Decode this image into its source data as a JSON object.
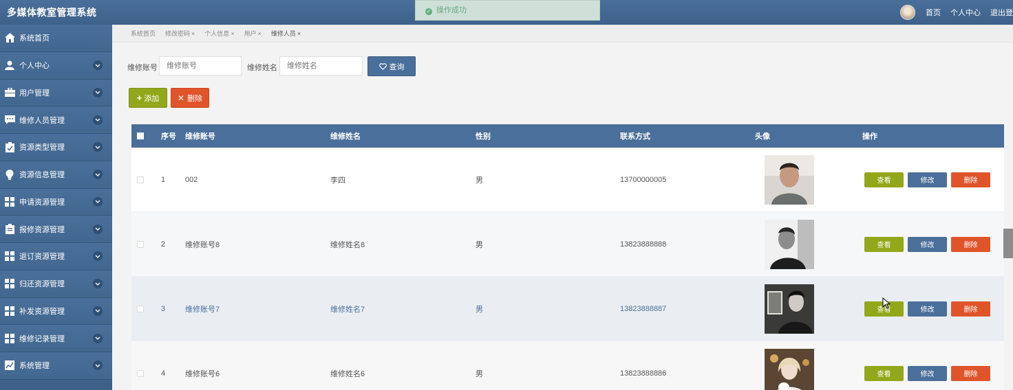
{
  "app": {
    "title": "多媒体教室管理系统"
  },
  "toast": {
    "text": "操作成功"
  },
  "topnav": {
    "home": "首页",
    "profile": "个人中心",
    "logout": "退出登"
  },
  "sidebar": {
    "items": [
      {
        "label": "系统首页",
        "icon": "home-icon"
      },
      {
        "label": "个人中心",
        "icon": "user-icon"
      },
      {
        "label": "用户管理",
        "icon": "briefcase-icon"
      },
      {
        "label": "维修人员管理",
        "icon": "chat-icon"
      },
      {
        "label": "资源类型管理",
        "icon": "clipboard-check-icon"
      },
      {
        "label": "资源信息管理",
        "icon": "bulb-icon"
      },
      {
        "label": "申请资源管理",
        "icon": "grid-icon"
      },
      {
        "label": "报修资源管理",
        "icon": "clipboard-icon"
      },
      {
        "label": "退订资源管理",
        "icon": "grid-icon"
      },
      {
        "label": "归还资源管理",
        "icon": "grid-icon"
      },
      {
        "label": "补发资源管理",
        "icon": "grid-icon"
      },
      {
        "label": "维修记录管理",
        "icon": "grid-icon"
      },
      {
        "label": "系统管理",
        "icon": "chart-icon"
      }
    ]
  },
  "tabs": [
    {
      "label": "系统首页",
      "closable": false
    },
    {
      "label": "修改密码",
      "closable": true
    },
    {
      "label": "个人信息",
      "closable": true
    },
    {
      "label": "用户",
      "closable": true
    },
    {
      "label": "维修人员",
      "closable": true
    }
  ],
  "search": {
    "account_label": "维修账号",
    "account_placeholder": "维修账号",
    "name_label": "维修姓名",
    "name_placeholder": "维修姓名",
    "query_button": "查询"
  },
  "toolbar": {
    "add_label": "添加",
    "delete_label": "删除"
  },
  "table": {
    "headers": [
      "序号",
      "维修账号",
      "维修姓名",
      "性别",
      "联系方式",
      "头像",
      "操作"
    ],
    "rows": [
      {
        "index": "1",
        "account": "002",
        "name": "李四",
        "gender": "男",
        "phone": "13700000005"
      },
      {
        "index": "2",
        "account": "维修账号8",
        "name": "维修姓名8",
        "gender": "男",
        "phone": "13823888888"
      },
      {
        "index": "3",
        "account": "维修账号7",
        "name": "维修姓名7",
        "gender": "男",
        "phone": "13823888887"
      },
      {
        "index": "4",
        "account": "维修账号6",
        "name": "维修姓名6",
        "gender": "男",
        "phone": "13823888886"
      }
    ],
    "actions": {
      "view": "查看",
      "edit": "修改",
      "delete": "删除"
    }
  },
  "colors": {
    "primary": "#4a6f9a",
    "success": "#92a81a",
    "danger": "#e0542a"
  }
}
